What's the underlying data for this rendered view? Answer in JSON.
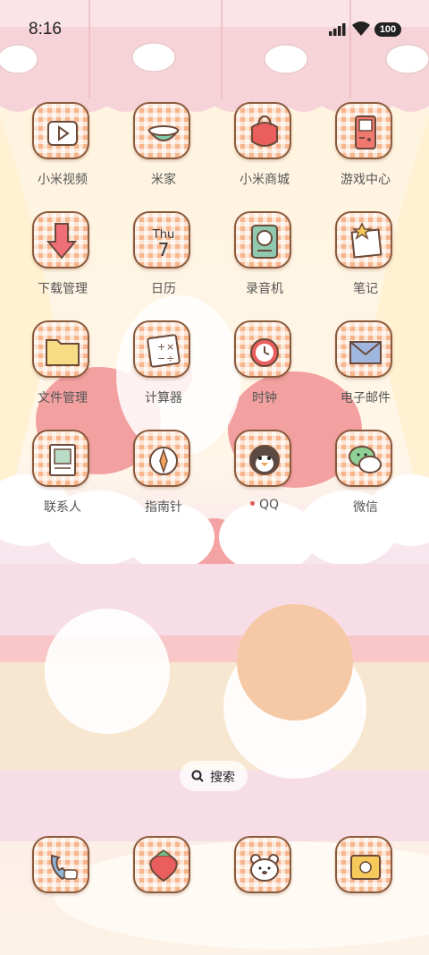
{
  "status_bar": {
    "time": "8:16",
    "battery": "100"
  },
  "apps": [
    {
      "label": "小米视频",
      "icon": "video-player-icon"
    },
    {
      "label": "米家",
      "icon": "bowl-icon"
    },
    {
      "label": "小米商城",
      "icon": "shopping-bag-icon"
    },
    {
      "label": "游戏中心",
      "icon": "game-console-icon"
    },
    {
      "label": "下载管理",
      "icon": "download-arrow-icon"
    },
    {
      "label": "日历",
      "icon": "calendar-icon",
      "day": "Thu",
      "date": "7"
    },
    {
      "label": "录音机",
      "icon": "recorder-icon"
    },
    {
      "label": "笔记",
      "icon": "notes-icon"
    },
    {
      "label": "文件管理",
      "icon": "folder-icon"
    },
    {
      "label": "计算器",
      "icon": "calculator-icon"
    },
    {
      "label": "时钟",
      "icon": "clock-icon"
    },
    {
      "label": "电子邮件",
      "icon": "envelope-icon"
    },
    {
      "label": "联系人",
      "icon": "contact-card-icon"
    },
    {
      "label": "指南针",
      "icon": "compass-icon"
    },
    {
      "label": "QQ",
      "icon": "penguin-icon",
      "notification": true
    },
    {
      "label": "微信",
      "icon": "chat-bubbles-icon"
    }
  ],
  "search": {
    "label": "搜索"
  },
  "dock": [
    {
      "icon": "phone-icon"
    },
    {
      "icon": "strawberry-browser-icon"
    },
    {
      "icon": "bear-face-icon"
    },
    {
      "icon": "wallet-icon"
    }
  ]
}
